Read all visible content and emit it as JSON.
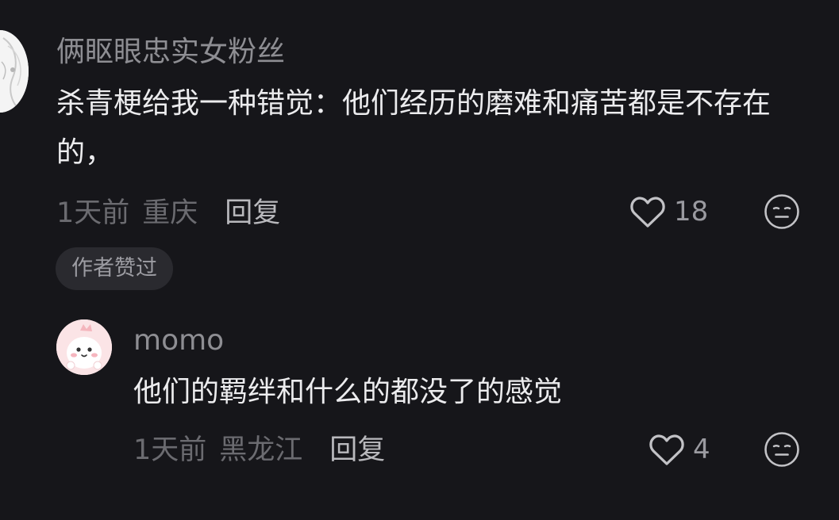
{
  "comment": {
    "username": "俩眍眼忠实女粉丝",
    "text": "杀青梗给我一种错觉：他们经历的磨难和痛苦都是不存在的，",
    "time": "1天前",
    "location": "重庆",
    "reply_label": "回复",
    "like_count": "18",
    "author_liked_label": "作者赞过"
  },
  "reply": {
    "username": "momo",
    "text": "他们的羁绊和什么的都没了的感觉",
    "time": "1天前",
    "location": "黑龙江",
    "reply_label": "回复",
    "like_count": "4"
  },
  "icons": {
    "like": "heart-icon",
    "dislike": "meh-face-icon"
  },
  "colors": {
    "background": "#16161a",
    "text_primary": "#ececee",
    "text_secondary": "#8e8e93",
    "text_meta": "#6b6b70",
    "chip_bg": "#2a2a2f"
  }
}
